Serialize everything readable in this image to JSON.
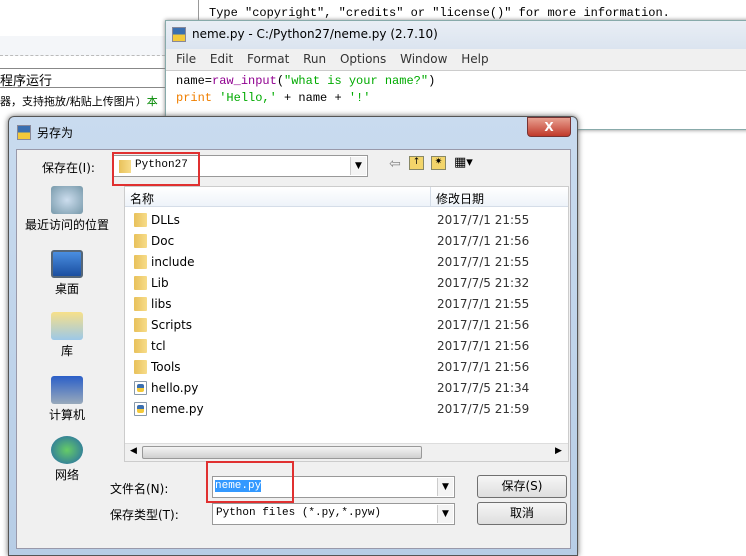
{
  "background_page": {
    "line1": "程序运行",
    "line2": "器，支持拖放/粘贴上传图片）",
    "line2_green": "本"
  },
  "shell": {
    "text": "Type \"copyright\", \"credits\" or \"license()\" for more information."
  },
  "editor": {
    "title": "neme.py - C:/Python27/neme.py (2.7.10)",
    "menu": [
      "File",
      "Edit",
      "Format",
      "Run",
      "Options",
      "Window",
      "Help"
    ],
    "code": {
      "l1a": "name=",
      "l1b": "raw_input",
      "l1c": "(",
      "l1d": "\"what is your name?\"",
      "l1e": ")",
      "l2a": "print",
      "l2b": " 'Hello,'",
      "l2c": " + name + ",
      "l2d": "'!'"
    }
  },
  "dialog": {
    "title": "另存为",
    "close": "X",
    "save_in_label": "保存在(I):",
    "save_in_value": "Python27",
    "places": [
      "最近访问的位置",
      "桌面",
      "库",
      "计算机",
      "网络"
    ],
    "columns": [
      "名称",
      "修改日期"
    ],
    "files": [
      {
        "name": "DLLs",
        "date": "2017/7/1 21:55",
        "type": "folder"
      },
      {
        "name": "Doc",
        "date": "2017/7/1 21:56",
        "type": "folder"
      },
      {
        "name": "include",
        "date": "2017/7/1 21:55",
        "type": "folder"
      },
      {
        "name": "Lib",
        "date": "2017/7/5 21:32",
        "type": "folder"
      },
      {
        "name": "libs",
        "date": "2017/7/1 21:55",
        "type": "folder"
      },
      {
        "name": "Scripts",
        "date": "2017/7/1 21:56",
        "type": "folder"
      },
      {
        "name": "tcl",
        "date": "2017/7/1 21:56",
        "type": "folder"
      },
      {
        "name": "Tools",
        "date": "2017/7/1 21:56",
        "type": "folder"
      },
      {
        "name": "hello.py",
        "date": "2017/7/5 21:34",
        "type": "python"
      },
      {
        "name": "neme.py",
        "date": "2017/7/5 21:59",
        "type": "python"
      }
    ],
    "filename_label": "文件名(N):",
    "filename_value": "neme.py",
    "filetype_label": "保存类型(T):",
    "filetype_value": "Python files (*.py,*.pyw)",
    "save_button": "保存(S)",
    "cancel_button": "取消",
    "highlight_color": "#e03030"
  }
}
